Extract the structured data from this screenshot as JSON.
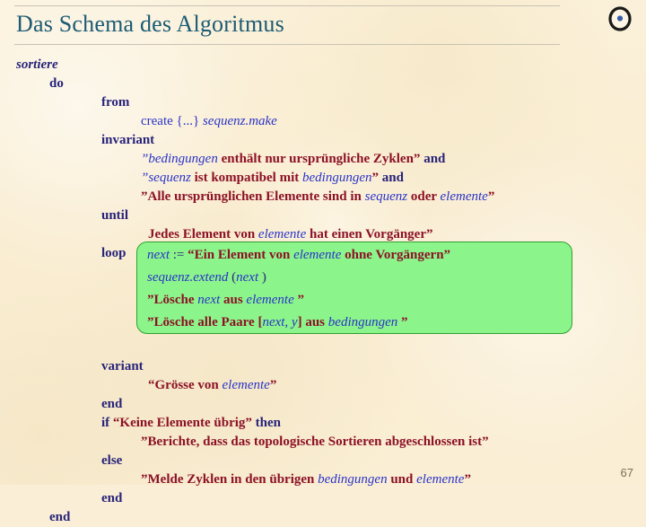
{
  "slide": {
    "title": "Das Schema des Algoritmus",
    "page_number": "67",
    "logo_icon": "eye-circle-icon",
    "background_color": "#faefd6",
    "title_color": "#1b5b74",
    "keyword_color": "#28237a",
    "string_color": "#8c1126",
    "variable_color": "#2a33c8",
    "highlight_fill": "#8bf58b",
    "highlight_border": "#30a030"
  },
  "code": {
    "l01_sortiere": "sortiere",
    "l02_do": "do",
    "l03_from": "from",
    "l04_create_kw": "create",
    "l04_braces": "{...}",
    "l04_target": "sequenz.make",
    "l05_invariant": "invariant",
    "l06_q1": "”bedingungen",
    "l06_t1": " enthält nur ursprüngliche Zyklen” ",
    "l06_and": "and",
    "l07_q1": "”sequenz",
    "l07_t1": " ist kompatibel mit ",
    "l07_v1": "bedingungen",
    "l07_t2": "” ",
    "l07_and": "and",
    "l08_t1": "”Alle ursprünglichen Elemente sind in ",
    "l08_v1": "sequenz",
    "l08_t2": " oder ",
    "l08_v2": "elemente",
    "l08_t3": "”",
    "l09_until": "until",
    "l10_t1": "Jedes Element von ",
    "l10_v1": "elemente",
    "l10_t2": " hat einen Vorgänger”",
    "l11_loop": "loop",
    "box_l1_v": "next",
    "box_l1_op": " := ",
    "box_l1_t1": "“Ein Element von ",
    "box_l1_v2": "elemente",
    "box_l1_t2": "  ohne Vorgängern”",
    "box_l2_v1": "sequenz.extend",
    "box_l2_t1": " (",
    "box_l2_v2": "next",
    "box_l2_t2": " )",
    "box_l3_t1": "”Lösche ",
    "box_l3_v1": "next",
    "box_l3_t2": " aus ",
    "box_l3_v2": "elemente",
    "box_l3_t3": " ”",
    "box_l4_t1": "”Lösche alle Paare [",
    "box_l4_v1": "next, y",
    "box_l4_t2": "] aus ",
    "box_l4_v2": "bedingungen",
    "box_l4_t3": " ”",
    "l16_variant": "variant",
    "l17_t1": "“Grösse von ",
    "l17_v1": "elemente",
    "l17_t2": "”",
    "l18_end": "end",
    "l19_if": "if ",
    "l19_cond": "“Keine Elemente übrig”",
    "l19_then": " then",
    "l20_t1": "”Berichte, dass das topologische Sortieren abgeschlossen ist”",
    "l21_else": "else",
    "l22_t1": "”Melde Zyklen in den übrigen ",
    "l22_v1": "bedingungen",
    "l22_t2": " und ",
    "l22_v2": "elemente",
    "l22_t3": "”",
    "l23_end": "end",
    "l24_end": "end"
  }
}
